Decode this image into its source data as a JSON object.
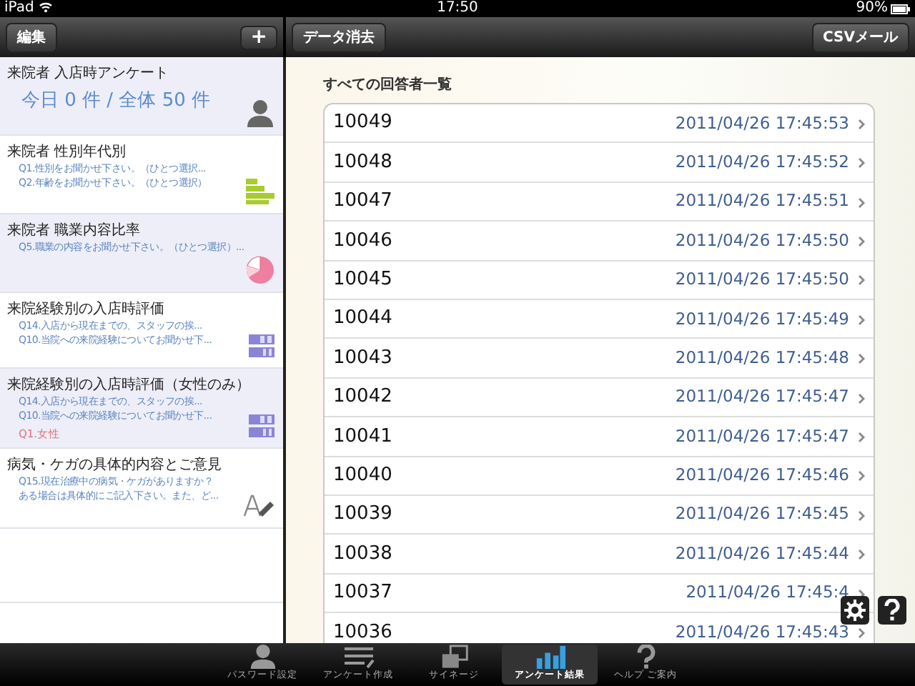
{
  "status_bar": {
    "device": "iPad",
    "time": "17:50",
    "battery": "90%"
  },
  "left_toolbar": {
    "edit_button": "編集",
    "add_button": "+"
  },
  "right_toolbar": {
    "clear_button": "データ消去",
    "csv_button": "CSVメール"
  },
  "surveys": [
    {
      "kind": "summary",
      "title": "来院者 入店時アンケート",
      "count": "今日 0 件 / 全体 50 件"
    },
    {
      "kind": "bar",
      "title": "来院者 性別年代別",
      "questions": [
        "Q1.性別をお聞かせ下さい。（ひとつ選択...",
        "Q2.年齢をお聞かせ下さい。（ひとつ選択）"
      ]
    },
    {
      "kind": "pie",
      "title": "来院者 職業内容比率",
      "questions": [
        "Q5.職業の内容をお聞かせ下さい。（ひとつ選択）..."
      ]
    },
    {
      "kind": "matrix",
      "title": "来院経験別の入店時評価",
      "questions": [
        "Q14.入店から現在までの、スタッフの挨...",
        "Q10.当院への来院経験についてお聞かせ下..."
      ]
    },
    {
      "kind": "matrix",
      "title": "来院経験別の入店時評価（女性のみ）",
      "questions": [
        "Q14.入店から現在までの、スタッフの挨...",
        "Q10.当院への来院経験についてお聞かせ下..."
      ],
      "filter": "Q1.女性"
    },
    {
      "kind": "text",
      "title": "病気・ケガの具体的内容とご意見",
      "questions": [
        "Q15.現在治療中の病気・ケガがありますか？",
        "ある場合は具体的にご記入下さい。また、ど..."
      ]
    }
  ],
  "respondents": {
    "heading": "すべての回答者一覧",
    "rows": [
      {
        "id": "10049",
        "time": "2011/04/26 17:45:53"
      },
      {
        "id": "10048",
        "time": "2011/04/26 17:45:52"
      },
      {
        "id": "10047",
        "time": "2011/04/26 17:45:51"
      },
      {
        "id": "10046",
        "time": "2011/04/26 17:45:50"
      },
      {
        "id": "10045",
        "time": "2011/04/26 17:45:50"
      },
      {
        "id": "10044",
        "time": "2011/04/26 17:45:49"
      },
      {
        "id": "10043",
        "time": "2011/04/26 17:45:48"
      },
      {
        "id": "10042",
        "time": "2011/04/26 17:45:47"
      },
      {
        "id": "10041",
        "time": "2011/04/26 17:45:47"
      },
      {
        "id": "10040",
        "time": "2011/04/26 17:45:46"
      },
      {
        "id": "10039",
        "time": "2011/04/26 17:45:45"
      },
      {
        "id": "10038",
        "time": "2011/04/26 17:45:44"
      },
      {
        "id": "10037",
        "time": "2011/04/26 17:45:4"
      },
      {
        "id": "10036",
        "time": "2011/04/26 17:45:43"
      }
    ]
  },
  "tab_bar": [
    {
      "kind": "person",
      "label": "パスワード設定",
      "selected": false
    },
    {
      "kind": "form",
      "label": "アンケート作成",
      "selected": false
    },
    {
      "kind": "signage",
      "label": "サイネージ",
      "selected": false
    },
    {
      "kind": "results",
      "label": "アンケート結果",
      "selected": true
    },
    {
      "kind": "help",
      "label": "ヘルプ ご案内",
      "selected": false
    }
  ]
}
